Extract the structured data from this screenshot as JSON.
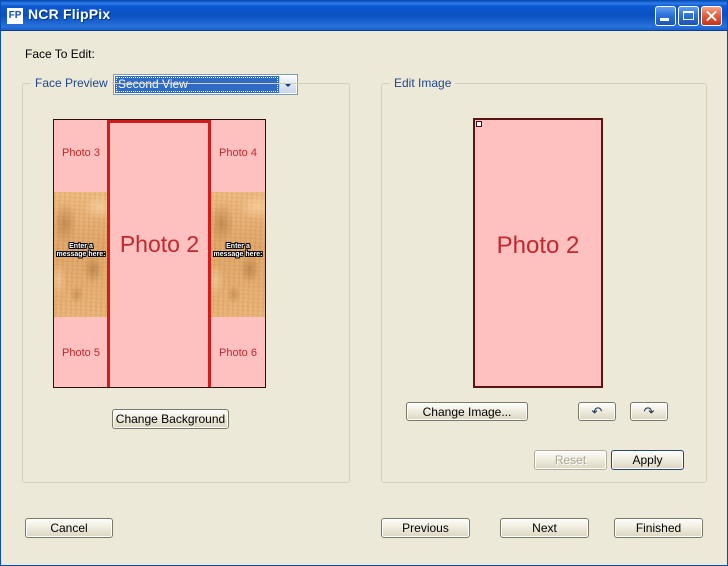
{
  "window": {
    "title": "NCR FlipPix",
    "icon_label": "FP",
    "controls": {
      "minimize": "minimize-button",
      "maximize": "maximize-button",
      "close": "close-button"
    }
  },
  "face_selector": {
    "label": "Face To Edit:",
    "value": "Second View",
    "options": [
      "Second View"
    ]
  },
  "face_preview": {
    "title": "Face Preview",
    "panels": [
      {
        "id": "left",
        "top_label": "Photo 3",
        "bottom_label": "Photo 5",
        "watermark_line1": "Enter a",
        "watermark_line2": "message here:"
      },
      {
        "id": "center",
        "label": "Photo 2"
      },
      {
        "id": "right",
        "top_label": "Photo 4",
        "bottom_label": "Photo 6",
        "watermark_line1": "Enter a",
        "watermark_line2": "message here:"
      }
    ],
    "change_background_label": "Change Background"
  },
  "edit_image": {
    "title": "Edit Image",
    "image_label": "Photo 2",
    "change_image_label": "Change Image...",
    "undo_glyph": "↶",
    "redo_glyph": "↷",
    "undo_name": "undo-button",
    "redo_name": "redo-button",
    "reset_label": "Reset",
    "reset_enabled": false,
    "apply_label": "Apply",
    "apply_enabled": true
  },
  "footer": {
    "cancel_label": "Cancel",
    "previous_label": "Previous",
    "next_label": "Next",
    "finished_label": "Finished"
  },
  "colors": {
    "titlebar_blue": "#0a51c3",
    "form_background": "#ece9d8",
    "group_title": "#20478b",
    "photo_fill": "#ffc0c0",
    "photo_text": "#c0282d",
    "divider_red": "#d41b1b",
    "texture_tan": "#e3a96a",
    "selection_blue": "#316ac5",
    "disabled_text": "#aca899"
  }
}
